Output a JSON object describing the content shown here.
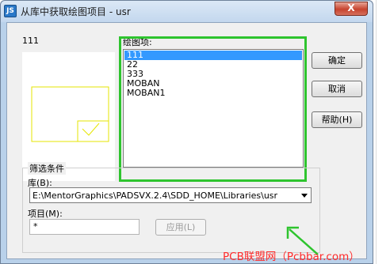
{
  "window": {
    "title": "从库中获取绘图项目 - usr",
    "app_icon": "pads-app-icon",
    "close_label": "X"
  },
  "preview": {
    "name": "111"
  },
  "drawing_items": {
    "label": "绘图项:",
    "items": [
      "111",
      "22",
      "333",
      "MOBAN",
      "MOBAN1"
    ],
    "selected": "111"
  },
  "buttons": {
    "ok": "确定",
    "cancel": "取消",
    "help": "帮助(H)",
    "apply": "应用(L)"
  },
  "filter": {
    "group_title": "筛选条件",
    "library_label": "库(B):",
    "library_value": "E:\\MentorGraphics\\PADSVX.2.4\\SDD_HOME\\Libraries\\usr",
    "item_label": "项目(M):",
    "item_value": "*"
  },
  "annotations": {
    "highlight_color": "#2ec42e"
  },
  "watermark": "PCB联盟网（Pcbbar.com）"
}
